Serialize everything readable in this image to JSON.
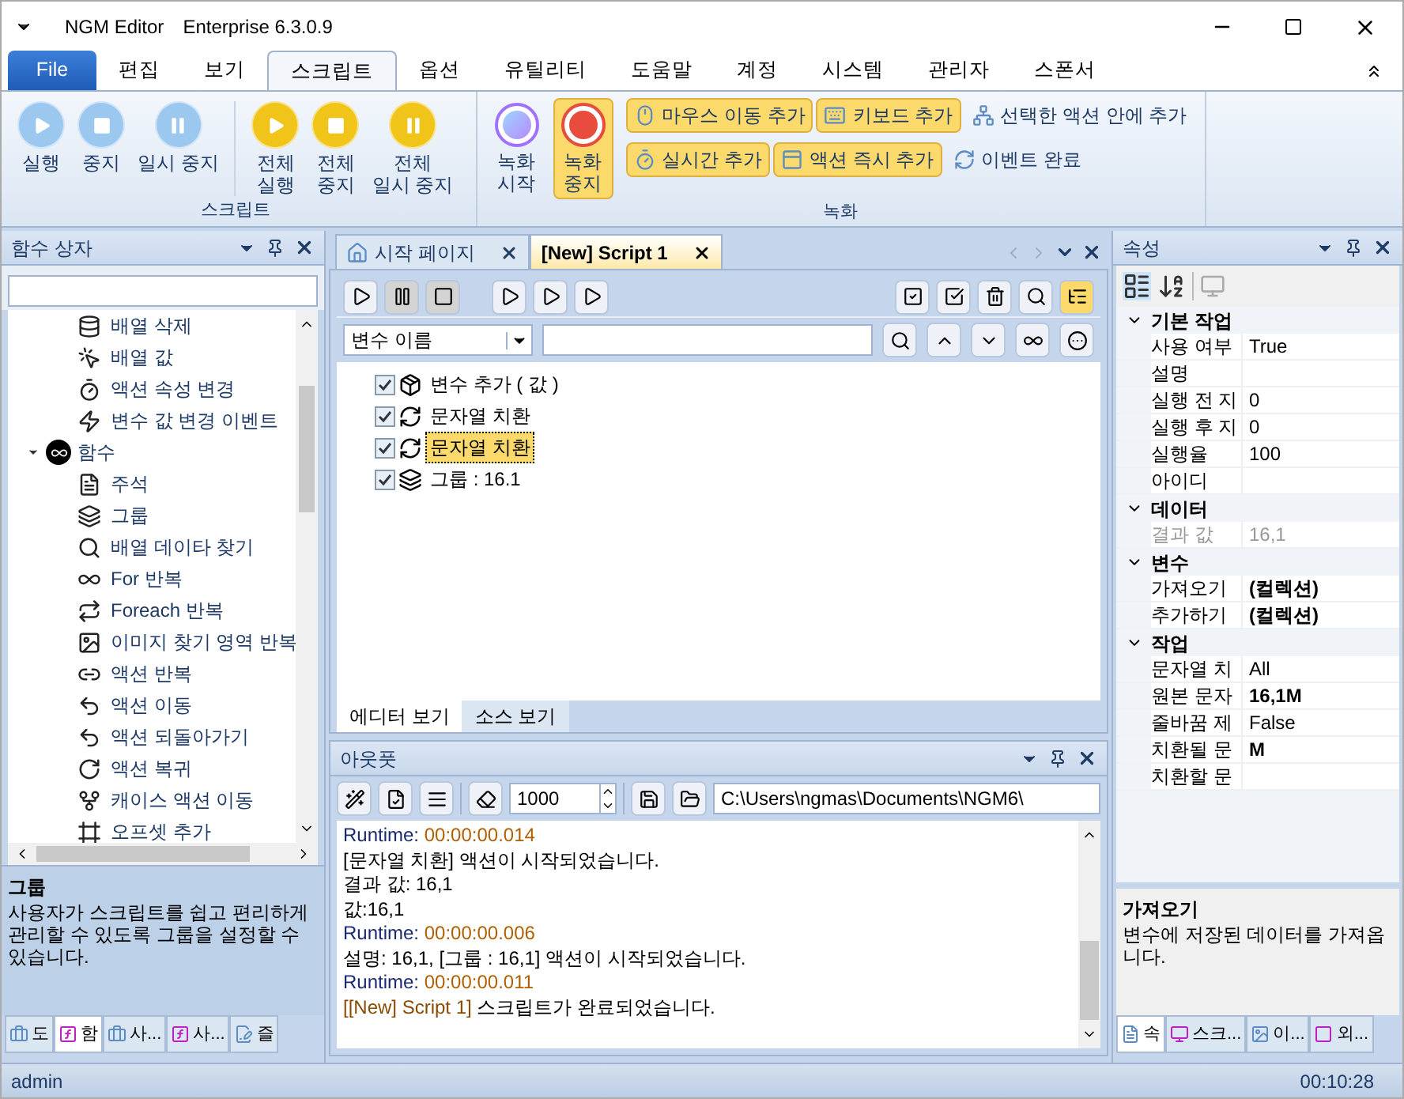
{
  "window": {
    "title": "NGM Editor",
    "edition": "Enterprise 6.3.0.9"
  },
  "menu_tabs": [
    {
      "label": "File",
      "kind": "file",
      "selected": false
    },
    {
      "label": "편집",
      "kind": "tab",
      "selected": false
    },
    {
      "label": "보기",
      "kind": "tab",
      "selected": false
    },
    {
      "label": "스크립트",
      "kind": "tab",
      "selected": true
    },
    {
      "label": "옵션",
      "kind": "tab",
      "selected": false
    },
    {
      "label": "유틸리티",
      "kind": "tab",
      "selected": false
    },
    {
      "label": "도움말",
      "kind": "tab",
      "selected": false
    },
    {
      "label": "계정",
      "kind": "tab",
      "selected": false
    },
    {
      "label": "시스템",
      "kind": "tab",
      "selected": false
    },
    {
      "label": "관리자",
      "kind": "tab",
      "selected": false
    },
    {
      "label": "스폰서",
      "kind": "tab",
      "selected": false
    }
  ],
  "ribbon": {
    "script_group": {
      "label": "스크립트",
      "buttons": [
        {
          "label": "실행",
          "kind": "play",
          "color": "#9cc8f0"
        },
        {
          "label": "중지",
          "kind": "stop",
          "color": "#9cc8f0"
        },
        {
          "label": "일시 중지",
          "kind": "pause",
          "color": "#9cc8f0"
        },
        {
          "label": "전체\n실행",
          "kind": "play",
          "color": "#f0c419"
        },
        {
          "label": "전체\n중지",
          "kind": "stop",
          "color": "#f0c419"
        },
        {
          "label": "전체\n일시 중지",
          "kind": "pause",
          "color": "#f0c419"
        }
      ]
    },
    "record_group": {
      "label": "녹화",
      "big_buttons": [
        {
          "label": "녹화\n시작",
          "kind": "record_start",
          "selected": false
        },
        {
          "label": "녹화\n중지",
          "kind": "record_stop",
          "selected": true
        }
      ],
      "small_buttons": [
        [
          {
            "label": "마우스 이동 추가",
            "highlighted": true
          },
          {
            "label": "키보드 추가",
            "highlighted": true
          },
          {
            "label": "선택한 액션 안에 추가",
            "highlighted": false
          }
        ],
        [
          {
            "label": "실시간 추가",
            "highlighted": true
          },
          {
            "label": "액션 즉시 추가",
            "highlighted": true
          },
          {
            "label": "이벤트 완료",
            "highlighted": false
          }
        ]
      ]
    }
  },
  "function_box": {
    "title": "함수 상자",
    "tree": [
      {
        "children": [
          {
            "label": "배열 삭제"
          },
          {
            "label": "배열 값"
          },
          {
            "label": "액션 속성 변경"
          },
          {
            "label": "변수 값 변경 이벤트"
          }
        ]
      },
      {
        "label": "함수",
        "expanded": true,
        "children": [
          {
            "label": "주석"
          },
          {
            "label": "그룹"
          },
          {
            "label": "배열 데이타 찾기"
          },
          {
            "label": "For 반복"
          },
          {
            "label": "Foreach 반복"
          },
          {
            "label": "이미지 찾기 영역 반복"
          },
          {
            "label": "액션 반복"
          },
          {
            "label": "액션 이동"
          },
          {
            "label": "액션 되돌아가기"
          },
          {
            "label": "액션 복귀"
          },
          {
            "label": "캐이스 액션 이동"
          },
          {
            "label": "오프셋 추가"
          }
        ]
      }
    ],
    "description": {
      "title": "그룹",
      "text": "사용자가 스크립트를 쉽고 편리하게 관리할 수 있도록 그룹을 설정할 수 있습니다."
    },
    "tabs": [
      {
        "label": "도",
        "selected": false
      },
      {
        "label": "함",
        "selected": true
      },
      {
        "label": "사...",
        "selected": false
      },
      {
        "label": "사...",
        "selected": false
      },
      {
        "label": "즐",
        "selected": false
      }
    ]
  },
  "editor": {
    "doc_tabs": [
      {
        "label": "시작 페이지",
        "selected": false
      },
      {
        "label": "[New] Script 1",
        "selected": true
      }
    ],
    "search_combo": {
      "value": "변수 이름"
    },
    "lines": [
      {
        "label": "변수 추가 ( 값 )",
        "checked": true,
        "selected": false
      },
      {
        "label": "문자열 치환",
        "checked": true,
        "selected": false
      },
      {
        "label": "문자열 치환",
        "checked": true,
        "selected": true
      },
      {
        "label": "그룹 : 16.1",
        "checked": true,
        "selected": false
      }
    ],
    "view_tabs": [
      {
        "label": "에디터 보기",
        "selected": true
      },
      {
        "label": "소스 보기",
        "selected": false
      }
    ]
  },
  "output": {
    "title": "아웃풋",
    "count": "1000",
    "path": "C:\\Users\\ngmas\\Documents\\NGM6\\",
    "lines": [
      {
        "kind": "runtime",
        "label": "Runtime:",
        "value": "00:00:00.014"
      },
      {
        "kind": "text",
        "text": "[문자열 치환] 액션이 시작되었습니다."
      },
      {
        "kind": "text",
        "text": "결과 값: 16,1"
      },
      {
        "kind": "text",
        "text": "값:16,1"
      },
      {
        "kind": "runtime",
        "label": "Runtime:",
        "value": "00:00:00.006"
      },
      {
        "kind": "text",
        "text": "설명: 16,1, [그룹 : 16,1] 액션이 시작되었습니다."
      },
      {
        "kind": "runtime",
        "label": "Runtime:",
        "value": "00:00:00.011"
      },
      {
        "kind": "done",
        "tag": "[[New] Script 1]",
        "text": "스크립트가 완료되었습니다."
      }
    ]
  },
  "properties": {
    "title": "속성",
    "groups": [
      {
        "name": "기본 작업",
        "expanded": true,
        "rows": [
          {
            "name": "사용 여부",
            "value": "True",
            "bold": false,
            "disabled": false
          },
          {
            "name": "설명",
            "disabled": false
          },
          {
            "name": "실행 전 지",
            "value": "0",
            "bold": false,
            "disabled": false
          },
          {
            "name": "실행 후 지",
            "value": "0",
            "bold": false,
            "disabled": false
          },
          {
            "name": "실행율",
            "value": "100",
            "bold": false,
            "disabled": false
          },
          {
            "name": "아이디",
            "disabled": false
          }
        ]
      },
      {
        "name": "데이터",
        "expanded": true,
        "rows": [
          {
            "name": "결과 값",
            "value": "16,1",
            "bold": false,
            "disabled": true
          }
        ]
      },
      {
        "name": "변수",
        "expanded": true,
        "rows": [
          {
            "name": "가져오기",
            "value": "(컬렉션)",
            "bold": true,
            "disabled": false
          },
          {
            "name": "추가하기",
            "value": "(컬렉션)",
            "bold": true,
            "disabled": false
          }
        ]
      },
      {
        "name": "작업",
        "expanded": true,
        "rows": [
          {
            "name": "문자열 치",
            "value": "All",
            "bold": false,
            "disabled": false
          },
          {
            "name": "원본 문자",
            "value": "16,1M",
            "bold": true,
            "disabled": false
          },
          {
            "name": "줄바꿈 제",
            "value": "False",
            "bold": false,
            "disabled": false
          },
          {
            "name": "치환될 문",
            "value": "M",
            "bold": true,
            "disabled": false
          },
          {
            "name": "치환할 문",
            "disabled": false
          }
        ]
      }
    ],
    "description": {
      "title": "가져오기",
      "text": "변수에 저장된 데이터를 가져옵니다."
    },
    "tabs": [
      {
        "label": "속",
        "selected": true
      },
      {
        "label": "스크...",
        "selected": false
      },
      {
        "label": "이...",
        "selected": false
      },
      {
        "label": "외...",
        "selected": false
      }
    ]
  },
  "status_bar": {
    "user": "admin",
    "time": "00:10:28"
  }
}
